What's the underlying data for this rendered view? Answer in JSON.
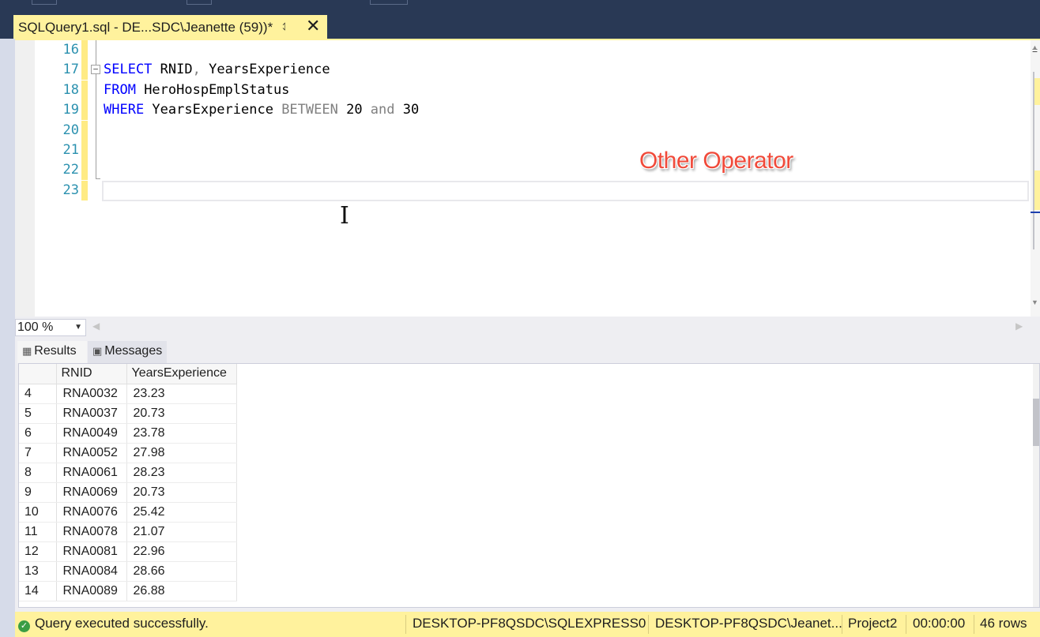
{
  "tab": {
    "title": "SQLQuery1.sql - DE...SDC\\Jeanette (59))*",
    "pin_icon": "pin-icon",
    "close_icon": "close-icon"
  },
  "editor": {
    "lines": [
      {
        "num": "16"
      },
      {
        "num": "17",
        "tokens": [
          {
            "t": "SELECT",
            "c": "kw"
          },
          {
            "t": " RNID"
          },
          {
            "t": ",",
            "c": "gray"
          },
          {
            "t": " YearsExperience"
          }
        ]
      },
      {
        "num": "18",
        "tokens": [
          {
            "t": "FROM",
            "c": "kw"
          },
          {
            "t": " HeroHospEmplStatus"
          }
        ]
      },
      {
        "num": "19",
        "tokens": [
          {
            "t": "WHERE",
            "c": "kw"
          },
          {
            "t": " YearsExperience "
          },
          {
            "t": "BETWEEN",
            "c": "gray"
          },
          {
            "t": " 20 "
          },
          {
            "t": "and",
            "c": "gray"
          },
          {
            "t": " 30"
          }
        ]
      },
      {
        "num": "20"
      },
      {
        "num": "21"
      },
      {
        "num": "22"
      },
      {
        "num": "23"
      }
    ],
    "annotation": "Other Operator"
  },
  "zoom": {
    "value": "100 %"
  },
  "results_tabs": {
    "results": "Results",
    "messages": "Messages"
  },
  "grid": {
    "columns": [
      "",
      "RNID",
      "YearsExperience"
    ],
    "rows": [
      [
        "4",
        "RNA0032",
        "23.23"
      ],
      [
        "5",
        "RNA0037",
        "20.73"
      ],
      [
        "6",
        "RNA0049",
        "23.78"
      ],
      [
        "7",
        "RNA0052",
        "27.98"
      ],
      [
        "8",
        "RNA0061",
        "28.23"
      ],
      [
        "9",
        "RNA0069",
        "20.73"
      ],
      [
        "10",
        "RNA0076",
        "25.42"
      ],
      [
        "11",
        "RNA0078",
        "21.07"
      ],
      [
        "12",
        "RNA0081",
        "22.96"
      ],
      [
        "13",
        "RNA0084",
        "28.66"
      ],
      [
        "14",
        "RNA0089",
        "26.88"
      ]
    ]
  },
  "status": {
    "message": "Query executed successfully.",
    "server": "DESKTOP-PF8QSDC\\SQLEXPRESS0...",
    "user": "DESKTOP-PF8QSDC\\Jeanet...",
    "database": "Project2",
    "elapsed": "00:00:00",
    "rows": "46 rows"
  },
  "colors": {
    "tab_gold": "#fff29d",
    "keyword_blue": "#0000ff",
    "line_number": "#2b91af",
    "annotation_red": "#f04a3a",
    "success_green": "#3a9d44"
  }
}
